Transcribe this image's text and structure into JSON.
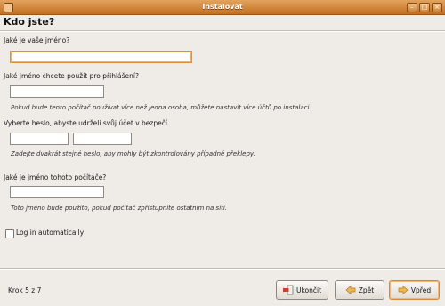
{
  "window": {
    "title": "Instalovat",
    "icons": [
      "window-menu-icon",
      "minimize-icon",
      "maximize-icon",
      "close-icon"
    ]
  },
  "page": {
    "heading": "Kdo jste?"
  },
  "form": {
    "name_label": "Jaké je vaše jméno?",
    "name_value": "",
    "login_label": "Jaké jméno chcete použít pro přihlášení?",
    "login_value": "",
    "login_hint": "Pokud bude tento počítač používat více než jedna osoba, můžete nastavit více účtů po instalaci.",
    "password_label": "Vyberte heslo, abyste udrželi svůj účet v bezpečí.",
    "password_value": "",
    "password_confirm_value": "",
    "password_hint": "Zadejte dvakrát stejné heslo, aby mohly být zkontrolovány případné překlepy.",
    "computer_label": "Jaké je jméno tohoto počítače?",
    "computer_value": "",
    "computer_hint": "Toto jméno bude použito, pokud počítač zpřístupníte ostatním na síti.",
    "auto_login_label": "Log in automatically",
    "auto_login_checked": false
  },
  "footer": {
    "step": "Krok 5 z 7",
    "quit_label": "Ukončit",
    "back_label": "Zpět",
    "next_label": "Vpřed"
  },
  "colors": {
    "titlebar": "#c8782a",
    "focus": "#e09039",
    "background": "#efebe7"
  }
}
